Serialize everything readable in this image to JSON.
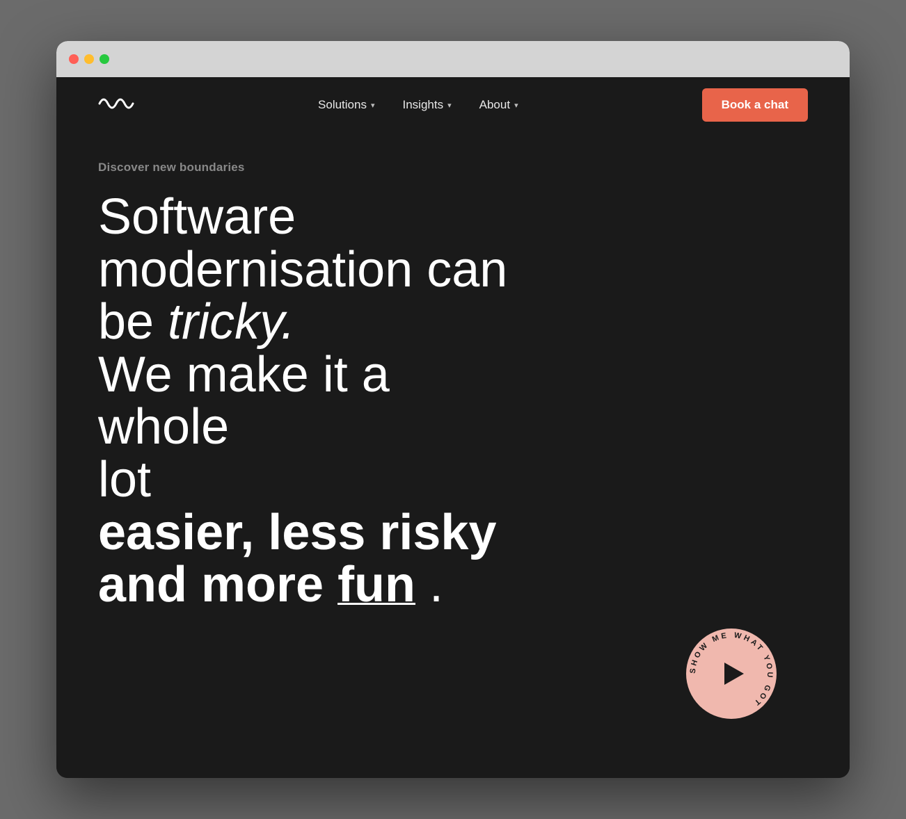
{
  "browser": {
    "traffic_lights": [
      "red",
      "yellow",
      "green"
    ]
  },
  "nav": {
    "logo_symbol": "∿∿",
    "links": [
      {
        "label": "Solutions",
        "has_dropdown": true
      },
      {
        "label": "Insights",
        "has_dropdown": true
      },
      {
        "label": "About",
        "has_dropdown": true
      }
    ],
    "cta_label": "Book a chat"
  },
  "hero": {
    "eyebrow": "Discover new boundaries",
    "heading_line1": "Software",
    "heading_line2": "modernisation can",
    "heading_line3_prefix": "be ",
    "heading_italic": "tricky.",
    "heading_line4": "We make it a whole",
    "heading_line5": "lot",
    "heading_bold1": "easier, less risky",
    "heading_bold2_prefix": "and more ",
    "heading_underline": "fun",
    "heading_period": " ."
  },
  "play_button": {
    "circular_text": "SHOW ME WHAT YOU GOT",
    "bg_color": "#f0b8ae"
  },
  "colors": {
    "bg": "#1a1a1a",
    "text": "#ffffff",
    "eyebrow": "#888888",
    "cta_bg": "#e8644a",
    "play_bg": "#f0b8ae"
  }
}
